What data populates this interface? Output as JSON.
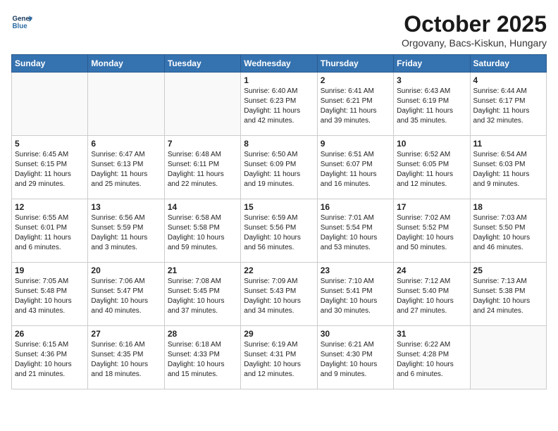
{
  "header": {
    "logo_line1": "General",
    "logo_line2": "Blue",
    "month": "October 2025",
    "location": "Orgovany, Bacs-Kiskun, Hungary"
  },
  "weekdays": [
    "Sunday",
    "Monday",
    "Tuesday",
    "Wednesday",
    "Thursday",
    "Friday",
    "Saturday"
  ],
  "weeks": [
    [
      {
        "day": "",
        "info": ""
      },
      {
        "day": "",
        "info": ""
      },
      {
        "day": "",
        "info": ""
      },
      {
        "day": "1",
        "info": "Sunrise: 6:40 AM\nSunset: 6:23 PM\nDaylight: 11 hours\nand 42 minutes."
      },
      {
        "day": "2",
        "info": "Sunrise: 6:41 AM\nSunset: 6:21 PM\nDaylight: 11 hours\nand 39 minutes."
      },
      {
        "day": "3",
        "info": "Sunrise: 6:43 AM\nSunset: 6:19 PM\nDaylight: 11 hours\nand 35 minutes."
      },
      {
        "day": "4",
        "info": "Sunrise: 6:44 AM\nSunset: 6:17 PM\nDaylight: 11 hours\nand 32 minutes."
      }
    ],
    [
      {
        "day": "5",
        "info": "Sunrise: 6:45 AM\nSunset: 6:15 PM\nDaylight: 11 hours\nand 29 minutes."
      },
      {
        "day": "6",
        "info": "Sunrise: 6:47 AM\nSunset: 6:13 PM\nDaylight: 11 hours\nand 25 minutes."
      },
      {
        "day": "7",
        "info": "Sunrise: 6:48 AM\nSunset: 6:11 PM\nDaylight: 11 hours\nand 22 minutes."
      },
      {
        "day": "8",
        "info": "Sunrise: 6:50 AM\nSunset: 6:09 PM\nDaylight: 11 hours\nand 19 minutes."
      },
      {
        "day": "9",
        "info": "Sunrise: 6:51 AM\nSunset: 6:07 PM\nDaylight: 11 hours\nand 16 minutes."
      },
      {
        "day": "10",
        "info": "Sunrise: 6:52 AM\nSunset: 6:05 PM\nDaylight: 11 hours\nand 12 minutes."
      },
      {
        "day": "11",
        "info": "Sunrise: 6:54 AM\nSunset: 6:03 PM\nDaylight: 11 hours\nand 9 minutes."
      }
    ],
    [
      {
        "day": "12",
        "info": "Sunrise: 6:55 AM\nSunset: 6:01 PM\nDaylight: 11 hours\nand 6 minutes."
      },
      {
        "day": "13",
        "info": "Sunrise: 6:56 AM\nSunset: 5:59 PM\nDaylight: 11 hours\nand 3 minutes."
      },
      {
        "day": "14",
        "info": "Sunrise: 6:58 AM\nSunset: 5:58 PM\nDaylight: 10 hours\nand 59 minutes."
      },
      {
        "day": "15",
        "info": "Sunrise: 6:59 AM\nSunset: 5:56 PM\nDaylight: 10 hours\nand 56 minutes."
      },
      {
        "day": "16",
        "info": "Sunrise: 7:01 AM\nSunset: 5:54 PM\nDaylight: 10 hours\nand 53 minutes."
      },
      {
        "day": "17",
        "info": "Sunrise: 7:02 AM\nSunset: 5:52 PM\nDaylight: 10 hours\nand 50 minutes."
      },
      {
        "day": "18",
        "info": "Sunrise: 7:03 AM\nSunset: 5:50 PM\nDaylight: 10 hours\nand 46 minutes."
      }
    ],
    [
      {
        "day": "19",
        "info": "Sunrise: 7:05 AM\nSunset: 5:48 PM\nDaylight: 10 hours\nand 43 minutes."
      },
      {
        "day": "20",
        "info": "Sunrise: 7:06 AM\nSunset: 5:47 PM\nDaylight: 10 hours\nand 40 minutes."
      },
      {
        "day": "21",
        "info": "Sunrise: 7:08 AM\nSunset: 5:45 PM\nDaylight: 10 hours\nand 37 minutes."
      },
      {
        "day": "22",
        "info": "Sunrise: 7:09 AM\nSunset: 5:43 PM\nDaylight: 10 hours\nand 34 minutes."
      },
      {
        "day": "23",
        "info": "Sunrise: 7:10 AM\nSunset: 5:41 PM\nDaylight: 10 hours\nand 30 minutes."
      },
      {
        "day": "24",
        "info": "Sunrise: 7:12 AM\nSunset: 5:40 PM\nDaylight: 10 hours\nand 27 minutes."
      },
      {
        "day": "25",
        "info": "Sunrise: 7:13 AM\nSunset: 5:38 PM\nDaylight: 10 hours\nand 24 minutes."
      }
    ],
    [
      {
        "day": "26",
        "info": "Sunrise: 6:15 AM\nSunset: 4:36 PM\nDaylight: 10 hours\nand 21 minutes."
      },
      {
        "day": "27",
        "info": "Sunrise: 6:16 AM\nSunset: 4:35 PM\nDaylight: 10 hours\nand 18 minutes."
      },
      {
        "day": "28",
        "info": "Sunrise: 6:18 AM\nSunset: 4:33 PM\nDaylight: 10 hours\nand 15 minutes."
      },
      {
        "day": "29",
        "info": "Sunrise: 6:19 AM\nSunset: 4:31 PM\nDaylight: 10 hours\nand 12 minutes."
      },
      {
        "day": "30",
        "info": "Sunrise: 6:21 AM\nSunset: 4:30 PM\nDaylight: 10 hours\nand 9 minutes."
      },
      {
        "day": "31",
        "info": "Sunrise: 6:22 AM\nSunset: 4:28 PM\nDaylight: 10 hours\nand 6 minutes."
      },
      {
        "day": "",
        "info": ""
      }
    ]
  ]
}
